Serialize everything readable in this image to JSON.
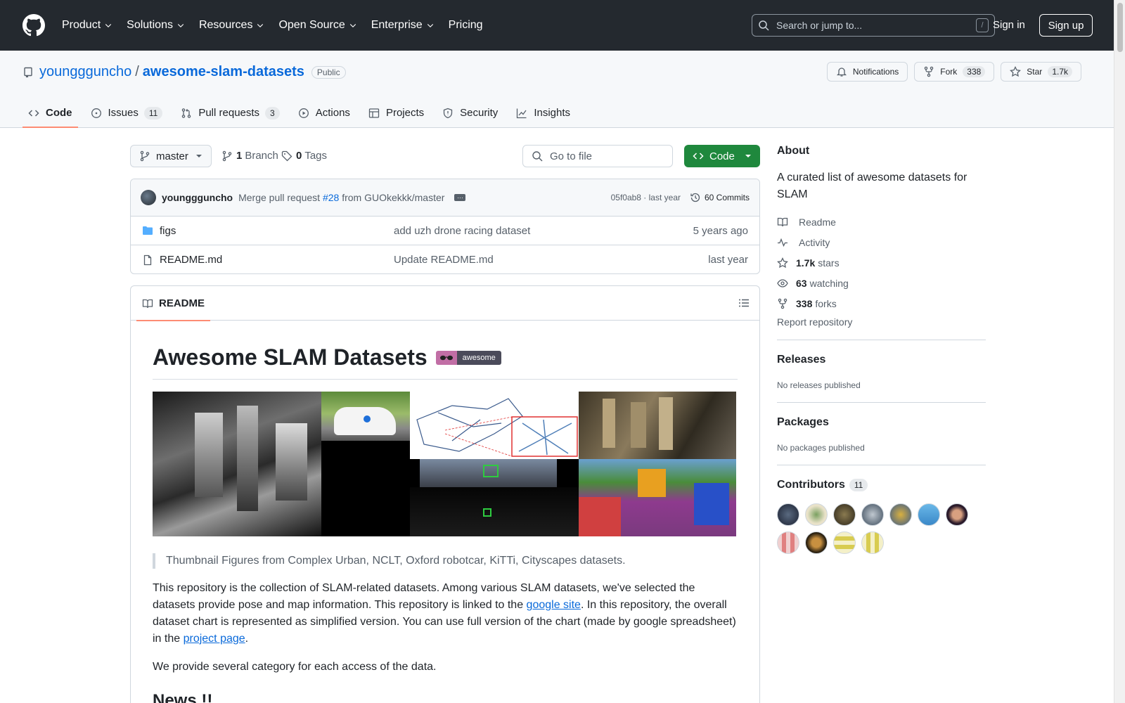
{
  "header": {
    "nav": [
      "Product",
      "Solutions",
      "Resources",
      "Open Source",
      "Enterprise",
      "Pricing"
    ],
    "search_placeholder": "Search or jump to...",
    "search_shortcut": "/",
    "sign_in": "Sign in",
    "sign_up": "Sign up"
  },
  "repo": {
    "owner": "younggguncho",
    "separator": "/",
    "name": "awesome-slam-datasets",
    "visibility": "Public",
    "notifications_label": "Notifications",
    "fork_label": "Fork",
    "fork_count": "338",
    "star_label": "Star",
    "star_count": "1.7k"
  },
  "tabs": [
    {
      "label": "Code",
      "icon": "code-icon",
      "count": ""
    },
    {
      "label": "Issues",
      "icon": "issue-opened-icon",
      "count": "11"
    },
    {
      "label": "Pull requests",
      "icon": "git-pull-request-icon",
      "count": "3"
    },
    {
      "label": "Actions",
      "icon": "play-icon",
      "count": ""
    },
    {
      "label": "Projects",
      "icon": "table-icon",
      "count": ""
    },
    {
      "label": "Security",
      "icon": "shield-icon",
      "count": ""
    },
    {
      "label": "Insights",
      "icon": "graph-icon",
      "count": ""
    }
  ],
  "branch": {
    "current": "master",
    "branch_count": "1",
    "branch_label": "Branch",
    "tag_count": "0",
    "tag_label": "Tags",
    "goto_placeholder": "Go to file",
    "code_label": "Code"
  },
  "last_commit": {
    "author": "younggguncho",
    "message_prefix": "Merge pull request",
    "pr_link": "#28",
    "message_suffix": "from GUOkekkk/master",
    "hash_time": "05f0ab8 · last year",
    "commits_label": "60 Commits"
  },
  "files": [
    {
      "name": "figs",
      "type": "folder",
      "commit": "add uzh drone racing dataset",
      "age": "5 years ago"
    },
    {
      "name": "README.md",
      "type": "file",
      "commit": "Update README.md",
      "age": "last year"
    }
  ],
  "readme": {
    "tab_label": "README",
    "title": "Awesome SLAM Datasets",
    "badge_text": "awesome",
    "quote": "Thumbnail Figures from Complex Urban, NCLT, Oxford robotcar, KiTTi, Cityscapes datasets.",
    "p1_a": "This repository is the collection of SLAM-related datasets. Among various SLAM datasets, we've selected the datasets provide pose and map information. This repository is linked to the ",
    "p1_link1": "google site",
    "p1_b": ". In this repository, the overall dataset chart is represented as simplified version. You can use full version of the chart (made by google spreadsheet) in the ",
    "p1_link2": "project page",
    "p1_c": ".",
    "p2": "We provide several category for each access of the data.",
    "h2": "News !!"
  },
  "sidebar": {
    "about_title": "About",
    "description": "A curated list of awesome datasets for SLAM",
    "links": [
      {
        "icon": "book-icon",
        "bold": "",
        "text": "Readme"
      },
      {
        "icon": "pulse-icon",
        "bold": "",
        "text": "Activity"
      },
      {
        "icon": "star-icon",
        "bold": "1.7k",
        "text": "stars"
      },
      {
        "icon": "eye-icon",
        "bold": "63",
        "text": "watching"
      },
      {
        "icon": "repo-forked-icon",
        "bold": "338",
        "text": "forks"
      }
    ],
    "report": "Report repository",
    "releases_title": "Releases",
    "releases_text": "No releases published",
    "packages_title": "Packages",
    "packages_text": "No packages published",
    "contributors_title": "Contributors",
    "contributors_count": "11"
  },
  "colors": {
    "header_bg": "#24292f",
    "link": "#0969da",
    "code_button": "#1f883d",
    "tab_underline": "#fd8c73"
  }
}
